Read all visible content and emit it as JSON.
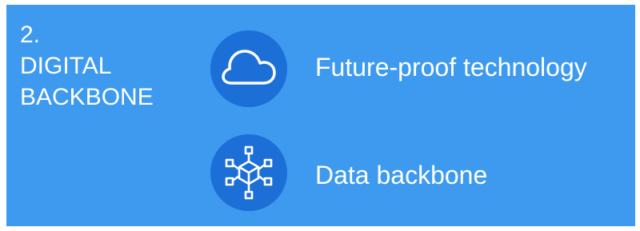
{
  "heading": {
    "number": "2.",
    "line1": "DIGITAL",
    "line2": "BACKBONE"
  },
  "items": [
    {
      "label": "Future-proof technology",
      "icon": "cloud-icon"
    },
    {
      "label": "Data backbone",
      "icon": "network-cube-icon"
    }
  ],
  "colors": {
    "panel": "#3d9aef",
    "icon_circle": "#1c6fd6",
    "text": "#ffffff"
  }
}
